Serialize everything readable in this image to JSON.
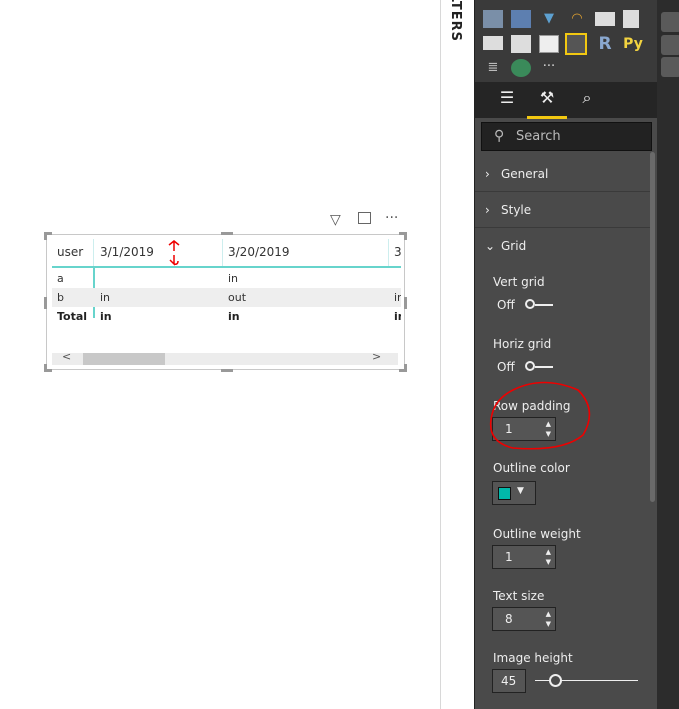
{
  "filters_pane": {
    "label": "FILTERS"
  },
  "visual": {
    "header_icons": [
      "filter-icon",
      "focus-mode-icon",
      "more-options-icon"
    ],
    "more_label": "···",
    "columns": [
      "user",
      "3/1/2019",
      "3/20/2019",
      "3"
    ],
    "rows": [
      {
        "user": "a",
        "c1": "",
        "c2": "in",
        "c3": ""
      },
      {
        "user": "b",
        "c1": "in",
        "c2": "out",
        "c3": "in"
      }
    ],
    "total": {
      "user": "Total",
      "c1": "in",
      "c2": "in",
      "c3": "in"
    },
    "scroll_left": "<",
    "scroll_right": ">",
    "outline_color": "#01b8aa"
  },
  "panel": {
    "visual_icons": [
      "map-icon",
      "filled-map-icon",
      "funnel-icon",
      "gauge-icon",
      "card-icon",
      "multirow-card-icon",
      "kpi-icon",
      "slicer-icon",
      "table-icon",
      "matrix-icon",
      "r-visual-icon",
      "python-visual-icon",
      "key-influencers-icon",
      "arcgis-map-icon",
      "more-visuals-icon"
    ],
    "r_label": "R",
    "py_label": "Py",
    "more_label": "···",
    "tabs": [
      "fields-tab",
      "format-tab",
      "analytics-tab"
    ],
    "active_tab": "format-tab",
    "search_placeholder": "Search",
    "sections": [
      {
        "label": "General",
        "expanded": false
      },
      {
        "label": "Style",
        "expanded": false
      },
      {
        "label": "Grid",
        "expanded": true
      }
    ],
    "grid": {
      "vert_grid_label": "Vert grid",
      "vert_grid_value": "Off",
      "horiz_grid_label": "Horiz grid",
      "horiz_grid_value": "Off",
      "row_padding_label": "Row padding",
      "row_padding_value": "1",
      "outline_color_label": "Outline color",
      "outline_color": "#01b8aa",
      "outline_weight_label": "Outline weight",
      "outline_weight_value": "1",
      "text_size_label": "Text size",
      "text_size_value": "8",
      "image_height_label": "Image height",
      "image_height_value": "45"
    },
    "accent": "#f2c811"
  }
}
